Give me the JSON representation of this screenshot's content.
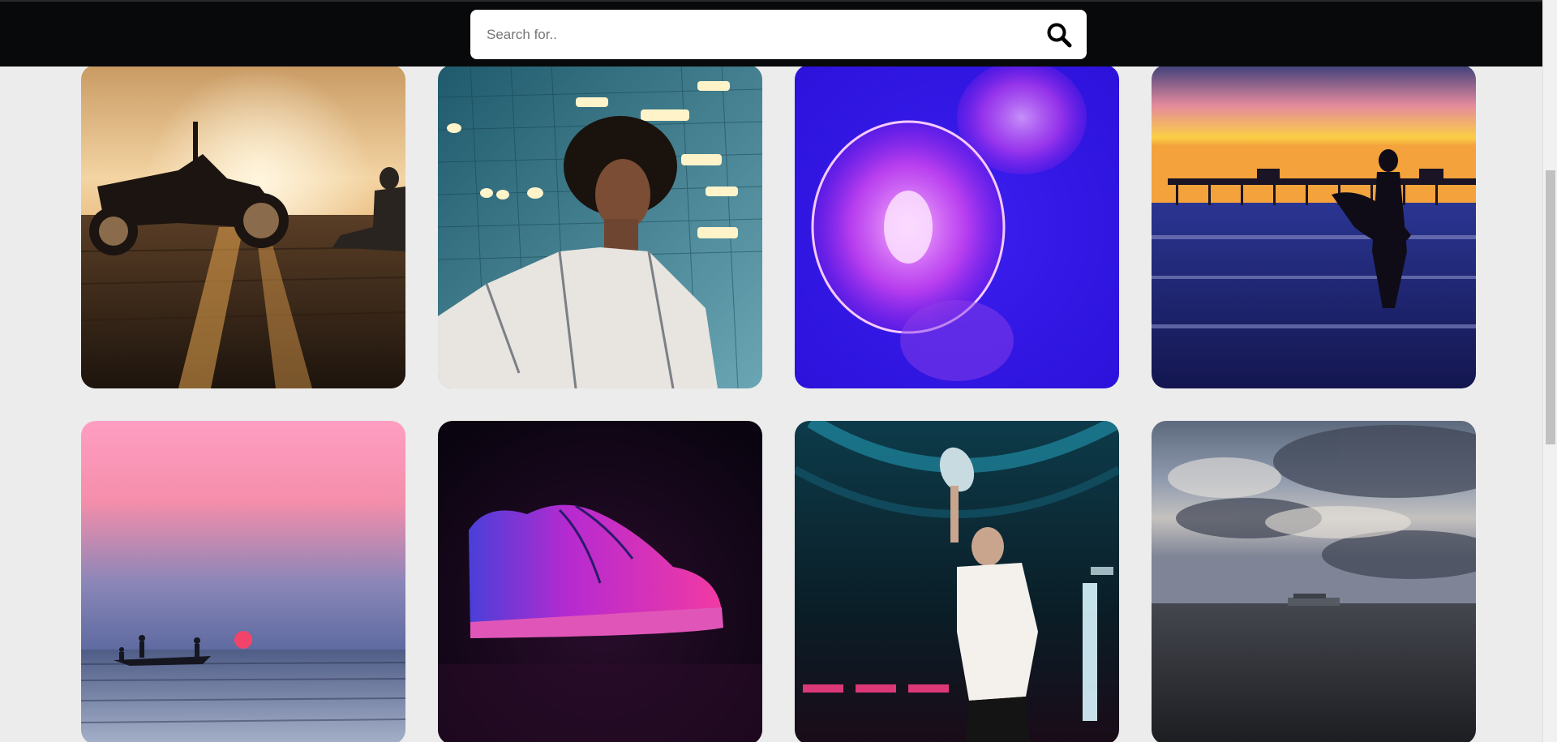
{
  "search": {
    "placeholder": "Search for..",
    "value": "",
    "icon": "search-icon"
  },
  "gallery": {
    "items": [
      {
        "name": "motorcycle-sunset-photo"
      },
      {
        "name": "woman-curly-hair-photo"
      },
      {
        "name": "jellyfish-photo"
      },
      {
        "name": "surfer-pier-sunset-photo"
      },
      {
        "name": "pink-sky-boat-photo"
      },
      {
        "name": "pink-sneaker-photo"
      },
      {
        "name": "man-neon-lights-photo"
      },
      {
        "name": "cloudy-beach-plane-photo"
      }
    ]
  },
  "colors": {
    "header_bg": "#08090b",
    "page_bg": "#ececec",
    "search_bg": "#ffffff"
  }
}
